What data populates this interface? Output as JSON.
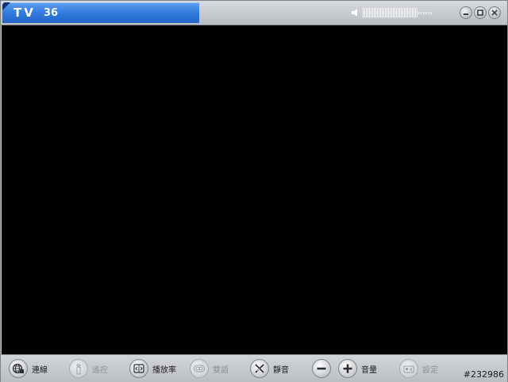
{
  "titlebar": {
    "mode": "TV",
    "channel": "36",
    "volume_level": 0.8
  },
  "controls": {
    "connect": "連線",
    "remote": "遙控",
    "rate": "播放率",
    "dual_audio": "雙語",
    "mute": "靜音",
    "volume": "音量",
    "settings": "設定"
  },
  "watermark": "#232986",
  "colors": {
    "title_accent": "#2f78dd",
    "video": "#000000",
    "chrome": "#c9cdd1"
  },
  "icons": [
    "speaker-icon",
    "minimize-icon",
    "maximize-icon",
    "close-icon",
    "globe-icon",
    "remote-icon",
    "rate-icon",
    "dual-audio-icon",
    "mute-icon",
    "minus-icon",
    "plus-icon",
    "settings-icon"
  ]
}
